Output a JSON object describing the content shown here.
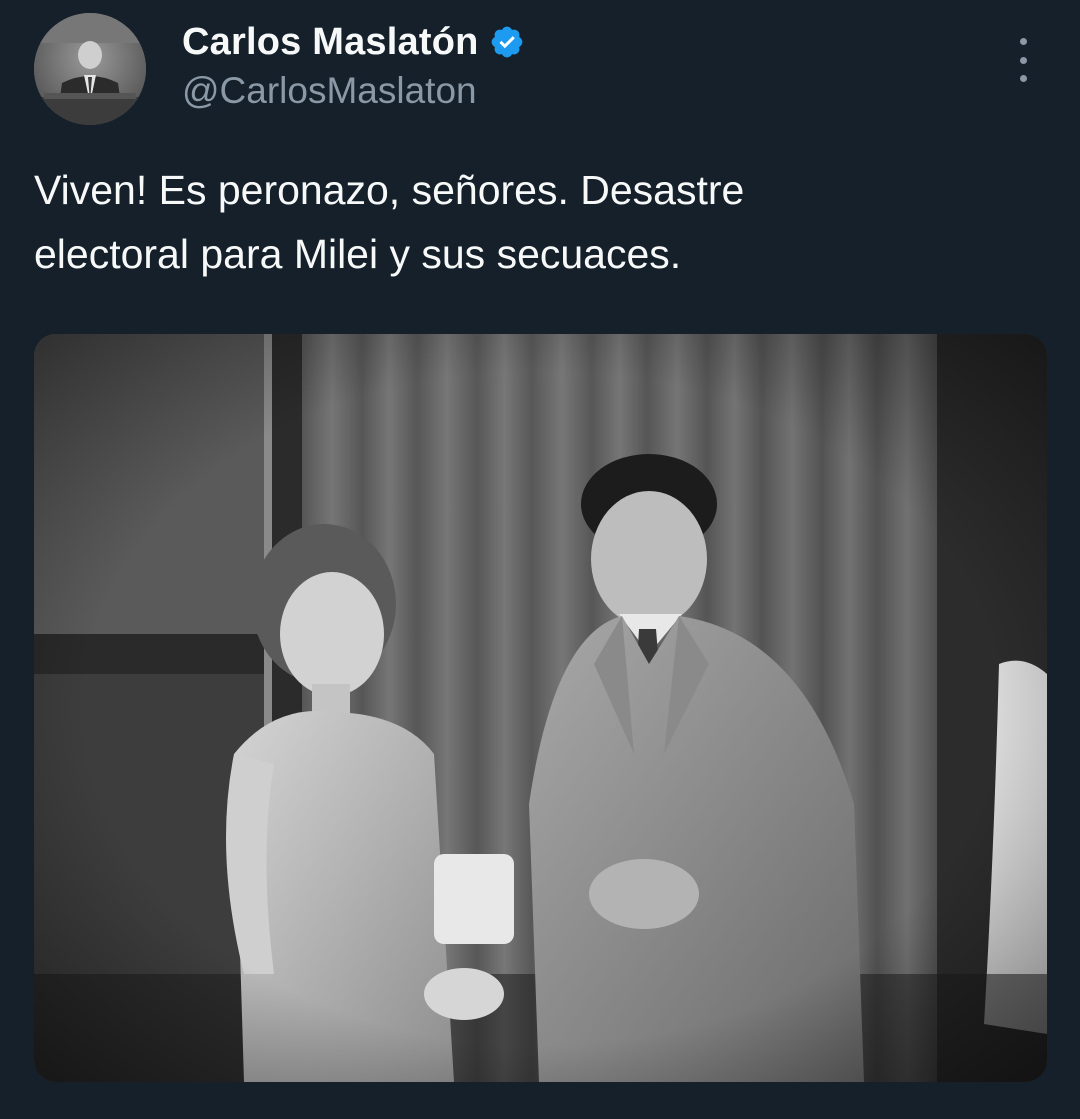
{
  "author": {
    "display_name": "Carlos Maslatón",
    "handle": "@CarlosMaslaton",
    "verified_icon": "verified-badge-icon",
    "avatar_icon": "avatar-photo"
  },
  "tweet": {
    "text": "Viven! Es peronazo, señores. Desastre\nelectoral para Milei y sus secuaces.",
    "more_icon": "more-options-icon",
    "media_type": "photo"
  },
  "colors": {
    "background": "#15202b",
    "primary_text": "#f7f9f9",
    "secondary_text": "#8b98a5",
    "verified": "#1d9bf0"
  }
}
